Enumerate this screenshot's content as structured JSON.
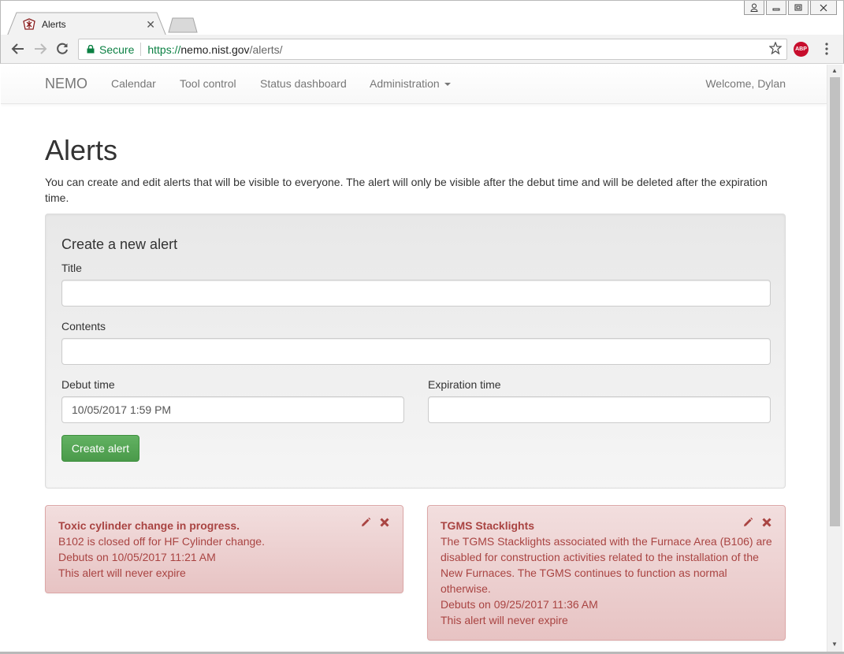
{
  "browser": {
    "tab_title": "Alerts",
    "secure_label": "Secure",
    "url_scheme": "https://",
    "url_host": "nemo.nist.gov",
    "url_path": "/alerts/",
    "abp_label": "ABP"
  },
  "navbar": {
    "brand": "NEMO",
    "links": [
      "Calendar",
      "Tool control",
      "Status dashboard",
      "Administration"
    ],
    "welcome": "Welcome, Dylan"
  },
  "page": {
    "title": "Alerts",
    "intro": "You can create and edit alerts that will be visible to everyone. The alert will only be visible after the debut time and will be deleted after the expiration time."
  },
  "form": {
    "heading": "Create a new alert",
    "title_label": "Title",
    "title_value": "",
    "contents_label": "Contents",
    "contents_value": "",
    "debut_label": "Debut time",
    "debut_value": "10/05/2017 1:59 PM",
    "expiration_label": "Expiration time",
    "expiration_value": "",
    "submit_label": "Create alert"
  },
  "alerts": [
    {
      "title": "Toxic cylinder change in progress.",
      "body": "B102 is closed off for HF Cylinder change.",
      "debut": "Debuts on 10/05/2017 11:21 AM",
      "expiry": "This alert will never expire"
    },
    {
      "title": "TGMS Stacklights",
      "body": "The TGMS Stacklights associated with the Furnace Area (B106) are disabled for construction activities related to the installation of the New Furnaces. The TGMS continues to function as normal otherwise.",
      "debut": "Debuts on 09/25/2017 11:36 AM",
      "expiry": "This alert will never expire"
    }
  ],
  "colors": {
    "alert_text": "#a94442",
    "alert_bg": "#f2dede",
    "success": "#5cb85c",
    "secure_green": "#0b8043"
  }
}
